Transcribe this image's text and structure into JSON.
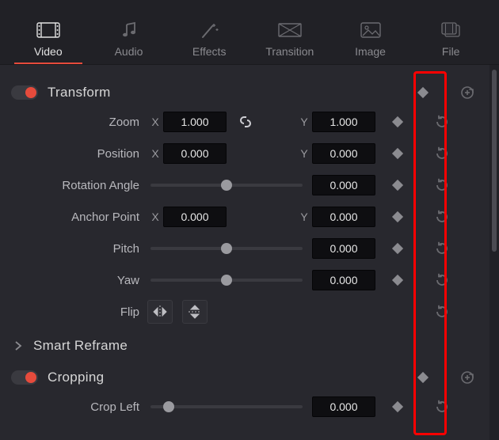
{
  "tabs": {
    "video": {
      "label": "Video"
    },
    "audio": {
      "label": "Audio"
    },
    "effects": {
      "label": "Effects"
    },
    "transition": {
      "label": "Transition"
    },
    "image": {
      "label": "Image"
    },
    "file": {
      "label": "File"
    }
  },
  "sections": {
    "transform": {
      "title": "Transform"
    },
    "smart_reframe": {
      "title": "Smart Reframe"
    },
    "cropping": {
      "title": "Cropping"
    }
  },
  "transform": {
    "zoom": {
      "label": "Zoom",
      "x_label": "X",
      "y_label": "Y",
      "x": "1.000",
      "y": "1.000"
    },
    "position": {
      "label": "Position",
      "x_label": "X",
      "y_label": "Y",
      "x": "0.000",
      "y": "0.000"
    },
    "rotation": {
      "label": "Rotation Angle",
      "value": "0.000"
    },
    "anchor": {
      "label": "Anchor Point",
      "x_label": "X",
      "y_label": "Y",
      "x": "0.000",
      "y": "0.000"
    },
    "pitch": {
      "label": "Pitch",
      "value": "0.000"
    },
    "yaw": {
      "label": "Yaw",
      "value": "0.000"
    },
    "flip": {
      "label": "Flip"
    }
  },
  "cropping": {
    "crop_left": {
      "label": "Crop Left",
      "value": "0.000"
    }
  }
}
